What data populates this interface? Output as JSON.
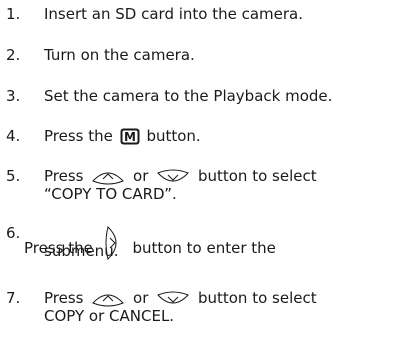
{
  "steps": [
    {
      "number": "1.",
      "text": "Insert an SD card into the camera."
    },
    {
      "number": "2.",
      "text": "Turn on the camera."
    },
    {
      "number": "3.",
      "text": "Set the camera to the Playback mode."
    },
    {
      "number": "4.",
      "text_before": "Press the",
      "icon": "m-button-icon",
      "icon_letter": "M",
      "text_after": "button."
    },
    {
      "number": "5.",
      "text_before": "Press",
      "icon1": "up-button-icon",
      "or": "or",
      "icon2": "down-button-icon",
      "text_after": "button to select",
      "line2": "“COPY TO CARD”."
    },
    {
      "number": "6.",
      "text_before": "Press the",
      "icon": "right-button-icon",
      "text_after": "button to enter the",
      "line2": "submenu."
    },
    {
      "number": "7.",
      "text_before": "Press",
      "icon1": "up-button-icon",
      "or": "or",
      "icon2": "down-button-icon",
      "text_after": "button to select",
      "line2": "COPY or CANCEL."
    }
  ]
}
